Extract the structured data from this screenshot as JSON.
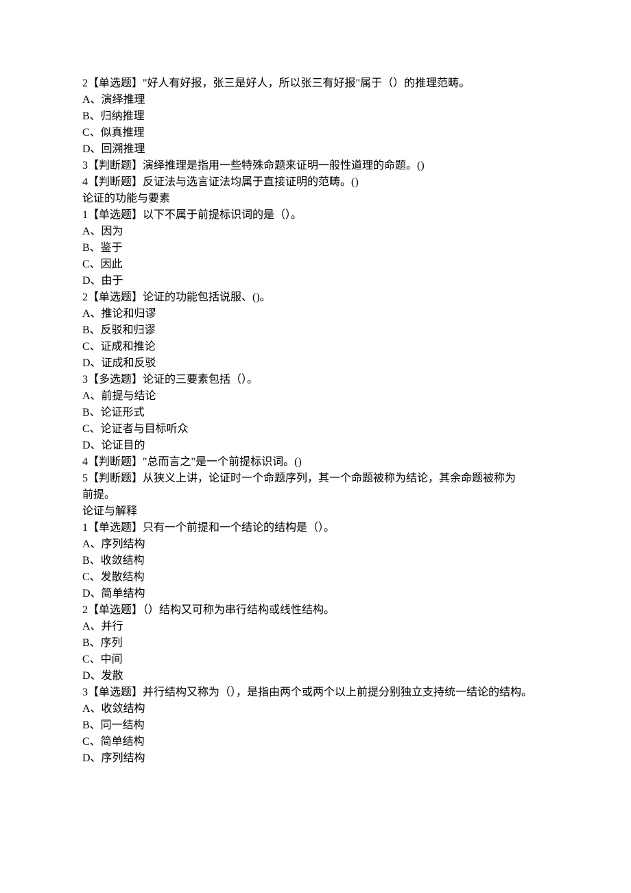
{
  "lines": [
    "2【单选题】\"好人有好报，张三是好人，所以张三有好报\"属于（）的推理范畴。",
    "A、演绎推理",
    "B、归纳推理",
    "C、似真推理",
    "D、回溯推理",
    "3【判断题】演绎推理是指用一些特殊命题来证明一般性道理的命题。()",
    "4【判断题】反证法与选言证法均属于直接证明的范畴。()",
    "论证的功能与要素",
    "1【单选题】以下不属于前提标识词的是（）。",
    "A、因为",
    "B、鉴于",
    "C、因此",
    "D、由于",
    "2【单选题】论证的功能包括说服、()。",
    "A、推论和归谬",
    "B、反驳和归谬",
    "C、证成和推论",
    "D、证成和反驳",
    "3【多选题】论证的三要素包括（）。",
    "A、前提与结论",
    "B、论证形式",
    "C、论证者与目标听众",
    "D、论证目的",
    "4【判断题】\"总而言之\"是一个前提标识词。()",
    "5【判断题】从狭义上讲，论证时一个命题序列，其一个命题被称为结论，其余命题被称为",
    "前提。",
    "论证与解释",
    "1【单选题】只有一个前提和一个结论的结构是（）。",
    "A、序列结构",
    "B、收敛结构",
    "C、发散结构",
    "D、简单结构",
    "2【单选题】（）结构又可称为串行结构或线性结构。",
    "A、并行",
    "B、序列",
    "C、中间",
    "D、发散",
    "3【单选题】并行结构又称为（），是指由两个或两个以上前提分别独立支持统一结论的结构。",
    "A、收敛结构",
    "B、同一结构",
    "C、简单结构",
    "D、序列结构"
  ]
}
